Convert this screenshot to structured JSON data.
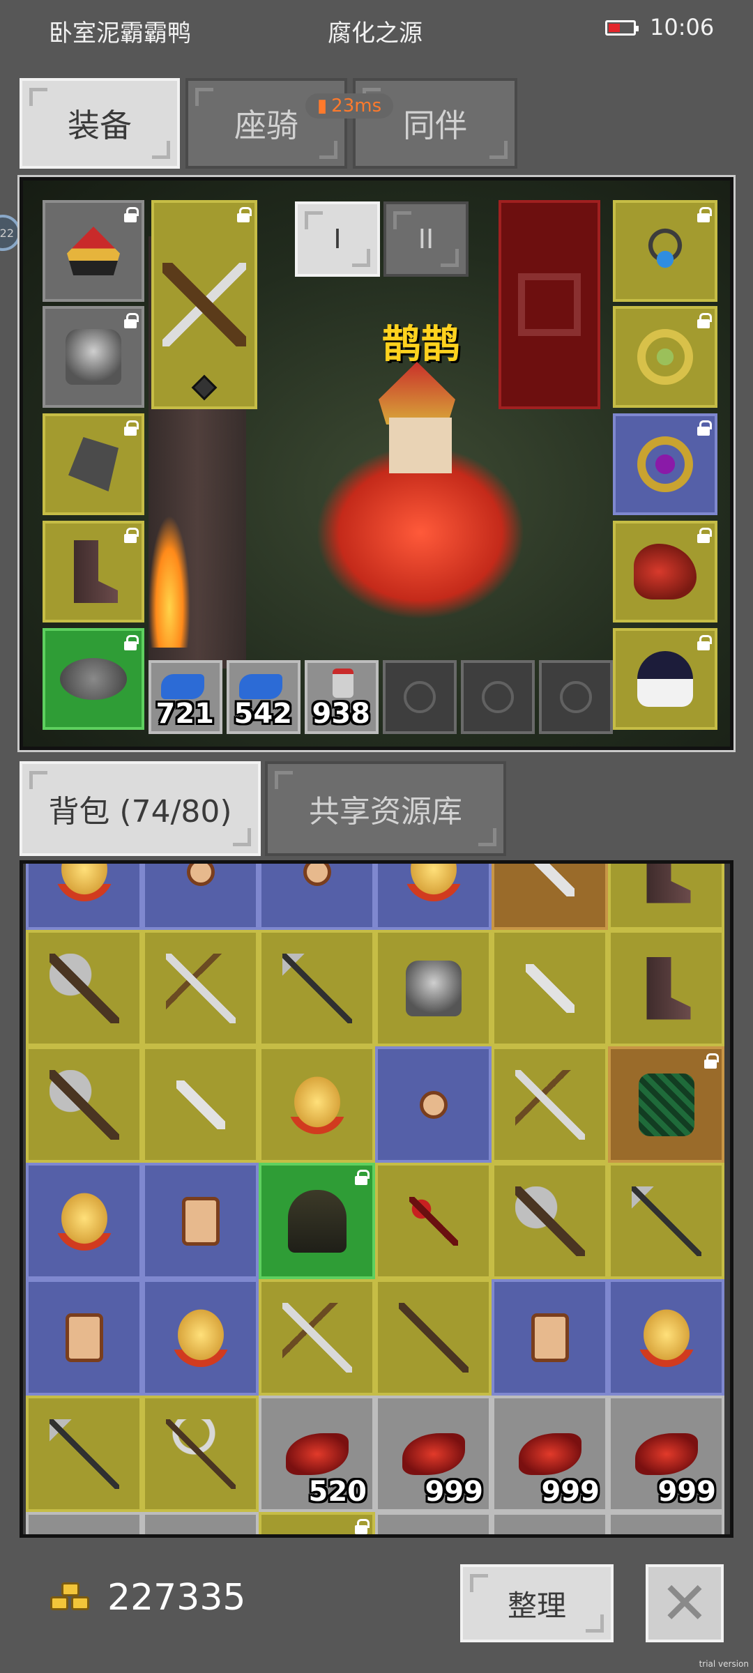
{
  "status_bar": {
    "left_text": "卧室泥霸霸鸭",
    "center_text": "腐化之源",
    "time": "10:06"
  },
  "tabs": [
    {
      "label": "装备",
      "active": true
    },
    {
      "label": "座骑",
      "active": false
    },
    {
      "label": "同伴",
      "active": false
    }
  ],
  "ping": "23ms",
  "side_badge": "22",
  "stage_tabs": [
    {
      "label": "I",
      "active": true
    },
    {
      "label": "II",
      "active": false
    }
  ],
  "pet_name": "鹊鹊",
  "consumables": [
    {
      "icon": "blue-potion-icon",
      "count": "721"
    },
    {
      "icon": "blue-potion-icon",
      "count": "542"
    },
    {
      "icon": "red-potion-bottle-icon",
      "count": "938"
    }
  ],
  "bag_tabs": [
    {
      "label": "背包 (74/80)",
      "active": true
    },
    {
      "label": "共享资源库",
      "active": false
    }
  ],
  "bag_counts": {
    "leaf1": "520",
    "leaf2": "999",
    "leaf3": "999",
    "leaf4": "999"
  },
  "gold": "227335",
  "sort_label": "整理",
  "trial_text": "trial version",
  "colors": {
    "yellow_slot": "#a39b2f",
    "blue_slot": "#5560a8",
    "green_slot": "#2f9d36",
    "orange_slot": "#9a6b2a",
    "gray_slot": "#8f8f8f"
  }
}
